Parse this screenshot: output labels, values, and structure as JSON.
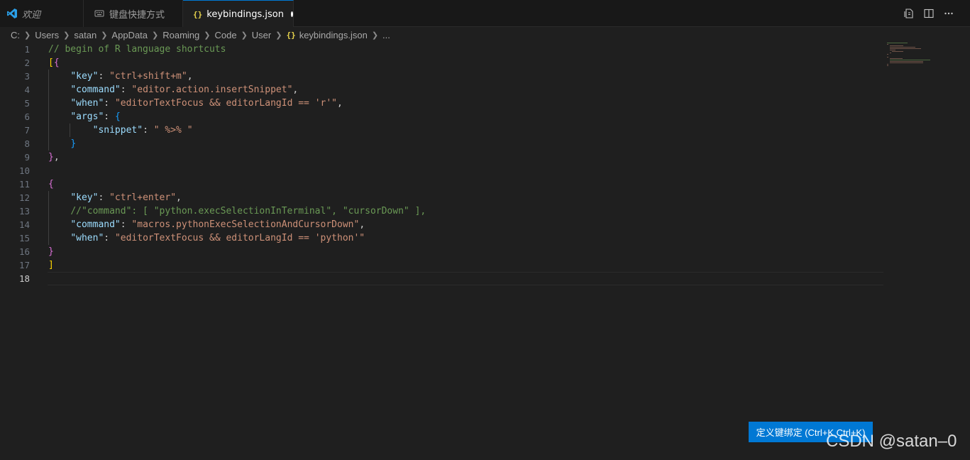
{
  "tabs": [
    {
      "label": "欢迎",
      "icon": "vscode-logo-icon"
    },
    {
      "label": "键盘快捷方式",
      "icon": "keyboard-icon"
    },
    {
      "label": "keybindings.json",
      "icon": "json-braces-icon",
      "modified": true
    }
  ],
  "breadcrumb": [
    "C:",
    "Users",
    "satan",
    "AppData",
    "Roaming",
    "Code",
    "User",
    "keybindings.json",
    "..."
  ],
  "breadcrumb_file_icon": "{}",
  "tab_json_icon_glyph": "{}",
  "editor": {
    "current_line": 18,
    "lines": [
      {
        "n": "1",
        "t": "// begin of R language shortcuts"
      },
      {
        "n": "2",
        "t": "[{"
      },
      {
        "n": "3",
        "t": "    \"key\": \"ctrl+shift+m\","
      },
      {
        "n": "4",
        "t": "    \"command\": \"editor.action.insertSnippet\","
      },
      {
        "n": "5",
        "t": "    \"when\": \"editorTextFocus && editorLangId == 'r'\","
      },
      {
        "n": "6",
        "t": "    \"args\": {"
      },
      {
        "n": "7",
        "t": "        \"snippet\": \" %>% \""
      },
      {
        "n": "8",
        "t": "    }"
      },
      {
        "n": "9",
        "t": "},"
      },
      {
        "n": "10",
        "t": ""
      },
      {
        "n": "11",
        "t": "{"
      },
      {
        "n": "12",
        "t": "    \"key\": \"ctrl+enter\","
      },
      {
        "n": "13",
        "t": "    //\"command\": [ \"python.execSelectionInTerminal\", \"cursorDown\" ],"
      },
      {
        "n": "14",
        "t": "    \"command\": \"macros.pythonExecSelectionAndCursorDown\","
      },
      {
        "n": "15",
        "t": "    \"when\": \"editorTextFocus && editorLangId == 'python'\""
      },
      {
        "n": "16",
        "t": "}"
      },
      {
        "n": "17",
        "t": "]"
      },
      {
        "n": "18",
        "t": ""
      }
    ]
  },
  "define_keybinding_button": "定义键绑定 (Ctrl+K Ctrl+K)",
  "watermark": "CSDN @satan–0",
  "colors": {
    "accent": "#0078d4",
    "comment": "#6a9955",
    "json_key": "#9cdcfe",
    "string": "#ce9178",
    "bracket_gold": "#ffd700",
    "bracket_purple": "#da70d6",
    "bracket_blue": "#179fff"
  }
}
